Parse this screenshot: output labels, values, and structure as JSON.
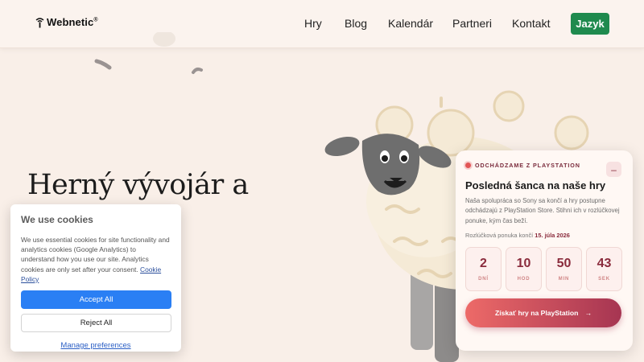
{
  "header": {
    "logo_text": "Webnetic",
    "logo_mark": "®",
    "nav": [
      "Hry",
      "Blog",
      "Kalendár",
      "Partneri",
      "Kontakt"
    ],
    "language_button": "Jazyk"
  },
  "hero": {
    "title": "Herný vývojár a"
  },
  "cookie": {
    "title": "We use cookies",
    "text": "We use essential cookies for site functionality and analytics cookies (Google Analytics) to understand how you use our site. Analytics cookies are only set after your consent.",
    "policy_link": "Cookie Policy",
    "accept": "Accept All",
    "reject": "Reject All",
    "manage": "Manage preferences"
  },
  "promo": {
    "eyebrow": "ODCHÁDZAME Z PLAYSTATION",
    "title": "Posledná šanca na naše hry",
    "description": "Naša spolupráca so Sony sa končí a hry postupne odchádzajú z PlayStation Store. Stihni ich v rozlúčkovej ponuke, kým čas beží.",
    "deadline_label": "Rozlúčková ponuka končí",
    "deadline_date": "15. júla 2026",
    "countdown": [
      {
        "value": "2",
        "label": "DNÍ"
      },
      {
        "value": "10",
        "label": "HOD"
      },
      {
        "value": "50",
        "label": "MIN"
      },
      {
        "value": "43",
        "label": "SEK"
      }
    ],
    "cta": "Získať hry na PlayStation",
    "cta_icon": "arrow-right-icon",
    "minimize_icon": "minus-icon"
  },
  "colors": {
    "accent_green": "#1f8a4e",
    "accept_blue": "#2a7ff4",
    "promo_maroon": "#8a2b3c"
  }
}
